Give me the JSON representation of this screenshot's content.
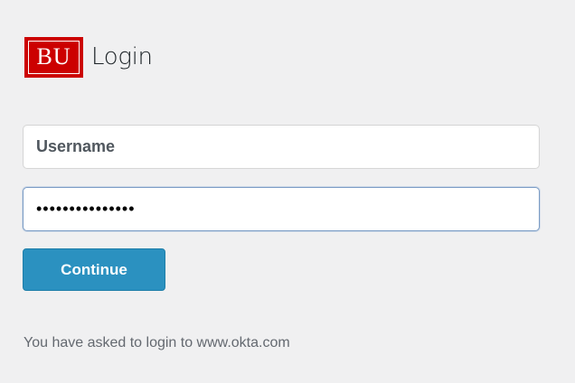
{
  "header": {
    "logo_text": "BU",
    "title": "Login"
  },
  "form": {
    "username_placeholder": "Username",
    "password_value": "•••••••••••••••",
    "continue_label": "Continue"
  },
  "footer": {
    "note": "You have asked to login to www.okta.com"
  },
  "colors": {
    "brand_red": "#cc0000",
    "button_blue": "#2b91c0",
    "background": "#f0f0f1"
  }
}
